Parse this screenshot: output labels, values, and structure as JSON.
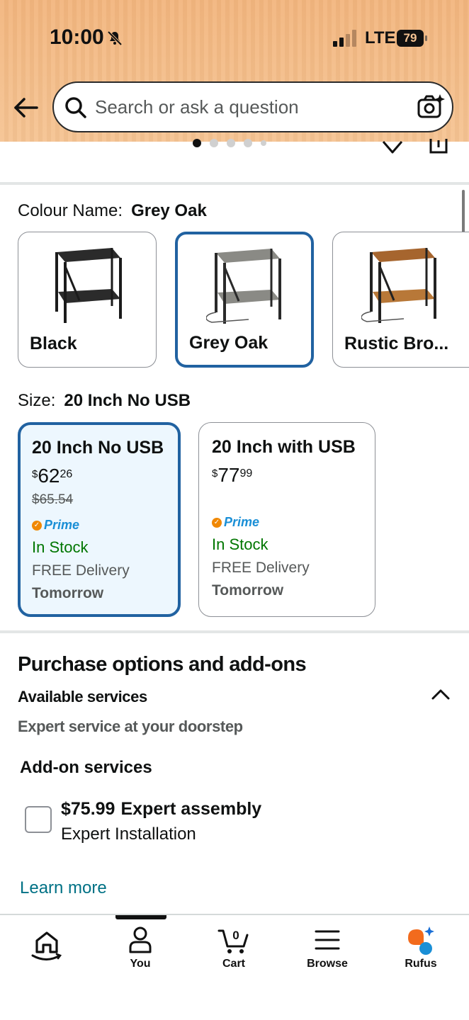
{
  "status_bar": {
    "time": "10:00",
    "network": "LTE",
    "battery": "79"
  },
  "search": {
    "placeholder": "Search or ask a question"
  },
  "carousel": {
    "dots": 5,
    "active_index": 0
  },
  "colour": {
    "label": "Colour Name:",
    "selected": "Grey Oak",
    "options": [
      {
        "name": "Black",
        "frame": "#1b1b1b",
        "shelf": "#2b2b2b"
      },
      {
        "name": "Grey Oak",
        "frame": "#2a2a2a",
        "shelf": "#8a8a85",
        "selected": true
      },
      {
        "name": "Rustic Bro...",
        "frame": "#222222",
        "shelf": "#a6652e"
      }
    ]
  },
  "size": {
    "label": "Size:",
    "selected": "20 Inch No USB",
    "options": [
      {
        "title": "20 Inch No USB",
        "price_symbol": "$",
        "price_whole": "62",
        "price_fraction": "26",
        "was_price": "$65.54",
        "prime": "Prime",
        "stock": "In Stock",
        "delivery": "FREE Delivery",
        "delivery_day": "Tomorrow"
      },
      {
        "title": "20 Inch with USB",
        "price_symbol": "$",
        "price_whole": "77",
        "price_fraction": "99",
        "prime": "Prime",
        "stock": "In Stock",
        "delivery": "FREE Delivery",
        "delivery_day": "Tomorrow"
      }
    ]
  },
  "purchase_options": {
    "title": "Purchase options and add-ons",
    "services_title": "Available services",
    "services_subtitle": "Expert service at your doorstep",
    "addon_title": "Add-on services",
    "addon": {
      "price": "$75.99",
      "name": "Expert assembly",
      "description": "Expert Installation",
      "checked": false
    },
    "learn_more": "Learn more"
  },
  "bottom_nav": {
    "items": [
      {
        "label": "",
        "icon": "home-icon"
      },
      {
        "label": "You",
        "icon": "user-icon",
        "active": true
      },
      {
        "label": "Cart",
        "icon": "cart-icon",
        "badge": "0"
      },
      {
        "label": "Browse",
        "icon": "menu-icon"
      },
      {
        "label": "Rufus",
        "icon": "rufus-icon"
      }
    ]
  },
  "colors": {
    "accent": "#2162a1",
    "link": "#007185",
    "in_stock": "#007600",
    "prime": "#1a8fd6",
    "header": "#f4bd88"
  }
}
